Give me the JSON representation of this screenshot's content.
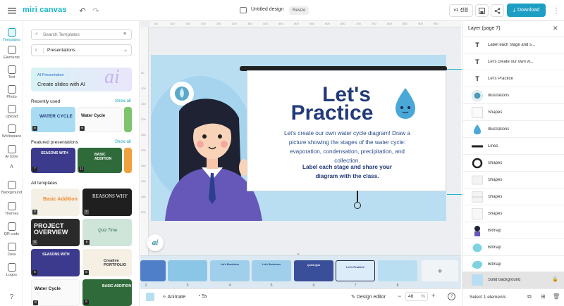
{
  "header": {
    "logo": "miri canvas",
    "title": "Untitled design",
    "resize": "Resize",
    "version": "v1 전환",
    "download": "Download"
  },
  "rail": [
    {
      "label": "Templates"
    },
    {
      "label": "Elements"
    },
    {
      "label": "Text"
    },
    {
      "label": "Photo"
    },
    {
      "label": "Upload"
    },
    {
      "label": "Workspace"
    },
    {
      "label": "AI tools"
    },
    {
      "label": "Background"
    },
    {
      "label": "Themes"
    },
    {
      "label": "QR code"
    },
    {
      "label": "Data"
    },
    {
      "label": "Logos"
    }
  ],
  "left_panel": {
    "search_placeholder": "Search Templates",
    "category": "Presentations",
    "ai_banner": {
      "small": "AI Presentation",
      "big": "Create slides with AI",
      "mark": "ai"
    },
    "recently_used": "Recently used",
    "show_all": "Show all",
    "featured": "Featured presentations",
    "all_templates": "All templates",
    "thumbs": {
      "recent1": "WATER CYCLE",
      "recent2": "Water Cycle",
      "feat1": "SEASONS WITH",
      "feat2": "BASIC ADDITION",
      "all1": "Basic Addition",
      "all2": "REASONS WHY",
      "all3": "PROJECT OVERVIEW",
      "all4": "Quiz Time",
      "all5": "SEASONS WITH",
      "all6": "Creative PORTFOLIO",
      "all7": "Water Cycle",
      "all8": "BASIC ADDITION"
    },
    "badges": [
      "8",
      "6",
      "7",
      "12",
      "8",
      "7",
      "5",
      "6",
      "6",
      "6",
      "8",
      "6"
    ]
  },
  "slide": {
    "heading1": "Let's",
    "heading2": "Practice",
    "body": "Let's create our own water cycle diagram! Draw a picture showing the stages of the water cycle: evaporation, condensation, precipitation, and collection.",
    "cta": "Label each stage and share your diagram with the class."
  },
  "ruler_h": [
    "50",
    "100",
    "150",
    "200",
    "250",
    "300",
    "350",
    "400",
    "450",
    "500",
    "550",
    "600",
    "650",
    "700",
    "750",
    "800",
    "850",
    "900",
    "950"
  ],
  "ruler_v": [
    "50",
    "100",
    "150",
    "200",
    "250",
    "300",
    "350",
    "400",
    "450",
    "500"
  ],
  "filmstrip": [
    {
      "num": "2",
      "title": ""
    },
    {
      "num": "3",
      "title": ""
    },
    {
      "num": "4",
      "title": "Let's Reminisce"
    },
    {
      "num": "5",
      "title": "Let's Reminisce"
    },
    {
      "num": "6",
      "title": "Quick Quiz"
    },
    {
      "num": "7",
      "title": "Let's Practice"
    },
    {
      "num": "8",
      "title": ""
    }
  ],
  "bottom": {
    "animate": "Animate",
    "duration": "5s",
    "design_editor": "Design editor",
    "zoom": "48",
    "zoom_unit": "%"
  },
  "right_panel": {
    "title": "Layer (page 7)",
    "layers": [
      {
        "icon": "T",
        "label": "Label each stage and s..."
      },
      {
        "icon": "T",
        "label": "Let's create our own w..."
      },
      {
        "icon": "T",
        "label": "Let's Practice"
      },
      {
        "icon": "",
        "label": "Illustrations"
      },
      {
        "icon": "",
        "label": "Shapes"
      },
      {
        "icon": "",
        "label": "Illustrations"
      },
      {
        "icon": "",
        "label": "Lines"
      },
      {
        "icon": "",
        "label": "Shapes"
      },
      {
        "icon": "",
        "label": "Shapes"
      },
      {
        "icon": "",
        "label": "Shapes"
      },
      {
        "icon": "",
        "label": "Shapes"
      },
      {
        "icon": "",
        "label": "Bitmap"
      },
      {
        "icon": "",
        "label": "Bitmap"
      },
      {
        "icon": "",
        "label": "Bitmap"
      },
      {
        "icon": "",
        "label": "Solid background"
      }
    ],
    "footer": "Select 1 elements"
  },
  "colors": {
    "accent": "#18a3b8",
    "download": "#1d9fc4",
    "slide_bg": "#b9def2",
    "heading": "#233a7a"
  }
}
